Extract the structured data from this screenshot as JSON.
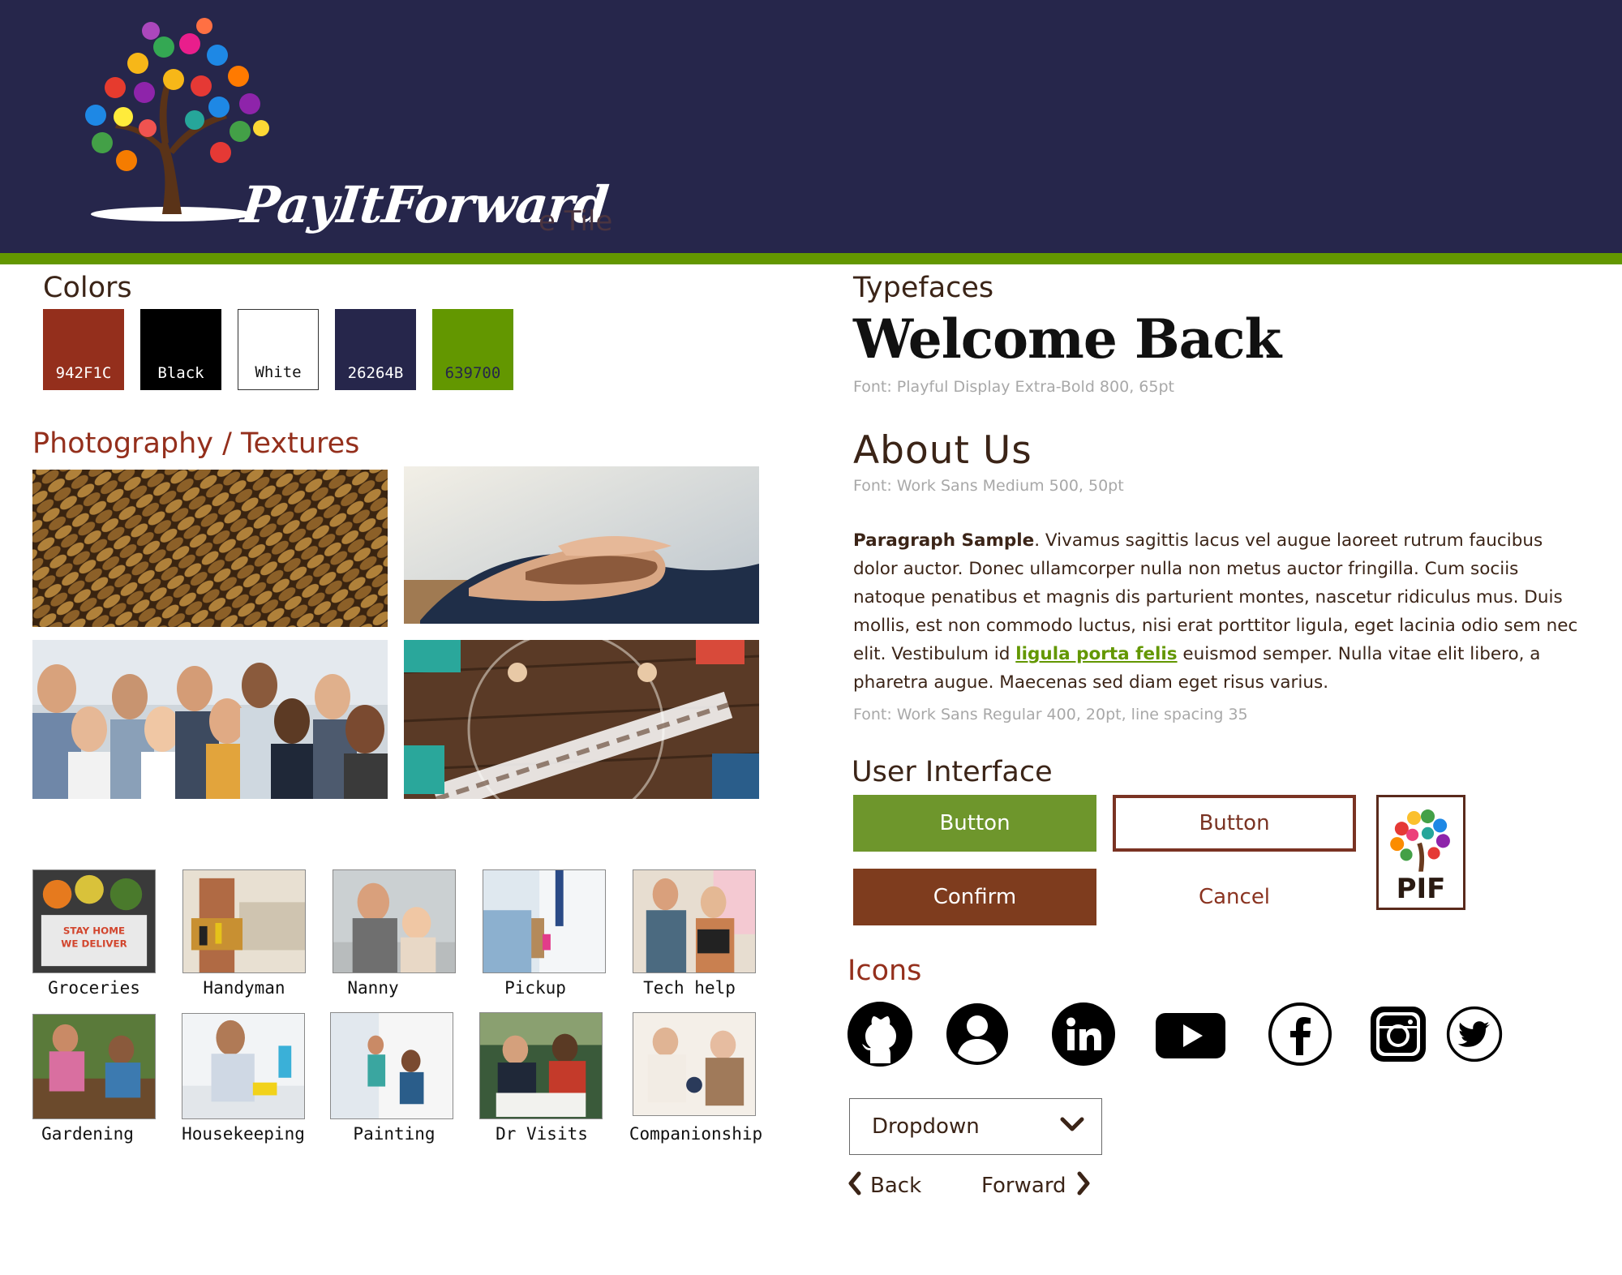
{
  "brand": {
    "logo_text": "PayItForward",
    "logo_ghost_text": "e Tile",
    "pif_text": "PIF"
  },
  "colors": {
    "heading": "Colors",
    "swatches": [
      {
        "label": "942F1C",
        "hex": "#942F1C",
        "text": "#ffffff"
      },
      {
        "label": "Black",
        "hex": "#000000",
        "text": "#ffffff"
      },
      {
        "label": "White",
        "hex": "#ffffff",
        "text": "#111111"
      },
      {
        "label": "26264B",
        "hex": "#26264B",
        "text": "#ffffff"
      },
      {
        "label": "639700",
        "hex": "#639700",
        "text": "#26264B"
      }
    ]
  },
  "photography": {
    "heading": "Photography / Textures"
  },
  "services": {
    "row1": [
      "Groceries",
      "Handyman",
      "Nanny",
      "Pickup",
      "Tech help"
    ],
    "row2": [
      "Gardening",
      "Housekeeping",
      "Painting",
      "Dr Visits",
      "Companionship"
    ]
  },
  "typefaces": {
    "heading": "Typefaces",
    "display_sample": "Welcome Back",
    "display_note": "Font: Playful Display Extra-Bold 800, 65pt",
    "heading_sample": "About Us",
    "heading_note": "Font: Work Sans Medium 500, 50pt",
    "paragraph_lead": "Paragraph Sample",
    "paragraph_part1": ". Vivamus sagittis lacus vel augue laoreet rutrum faucibus dolor auctor. Donec ullamcorper nulla non metus auctor fringilla. Cum sociis natoque penatibus et magnis dis parturient montes, nascetur ridiculus mus. Duis mollis, est non commodo luctus, nisi erat porttitor ligula, eget lacinia odio sem nec elit. Vestibulum id ",
    "paragraph_link": "ligula porta felis",
    "paragraph_part2": " euismod semper. Nulla vitae elit libero, a pharetra augue. Maecenas sed diam eget risus varius.",
    "paragraph_note": "Font: Work Sans Regular 400, 20pt, line spacing 35"
  },
  "ui": {
    "heading": "User Interface",
    "primary_button": "Button",
    "secondary_button": "Button",
    "confirm_button": "Confirm",
    "cancel_button": "Cancel"
  },
  "icons": {
    "heading": "Icons",
    "items": [
      "github-icon",
      "user-icon",
      "linkedin-icon",
      "youtube-icon",
      "facebook-icon",
      "instagram-icon",
      "twitter-icon"
    ]
  },
  "controls": {
    "dropdown_value": "Dropdown",
    "back_label": "Back",
    "forward_label": "Forward"
  }
}
